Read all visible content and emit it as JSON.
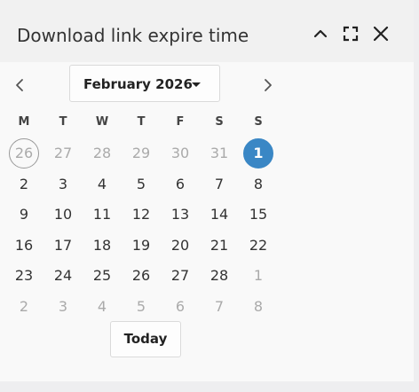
{
  "dialog": {
    "title": "Download link expire time",
    "icons": [
      "chevron-up-icon",
      "fullscreen-icon",
      "close-icon"
    ]
  },
  "calendar": {
    "month_label": "February 2026",
    "prev_icon": "chevron-left-icon",
    "next_icon": "chevron-right-icon",
    "weekdays": [
      "M",
      "T",
      "W",
      "T",
      "F",
      "S",
      "S"
    ],
    "weeks": [
      [
        "26",
        "27",
        "28",
        "29",
        "30",
        "31",
        "1"
      ],
      [
        "2",
        "3",
        "4",
        "5",
        "6",
        "7",
        "8"
      ],
      [
        "9",
        "10",
        "11",
        "12",
        "13",
        "14",
        "15"
      ],
      [
        "16",
        "17",
        "18",
        "19",
        "20",
        "21",
        "22"
      ],
      [
        "23",
        "24",
        "25",
        "26",
        "27",
        "28",
        "1"
      ],
      [
        "2",
        "3",
        "4",
        "5",
        "6",
        "7",
        "8"
      ]
    ],
    "today_day": "26",
    "selected_day": "1",
    "today_button_label": "Today"
  },
  "colors": {
    "selected": "#3a87c5",
    "muted_text": "#aaaaaa",
    "text": "#333333"
  }
}
